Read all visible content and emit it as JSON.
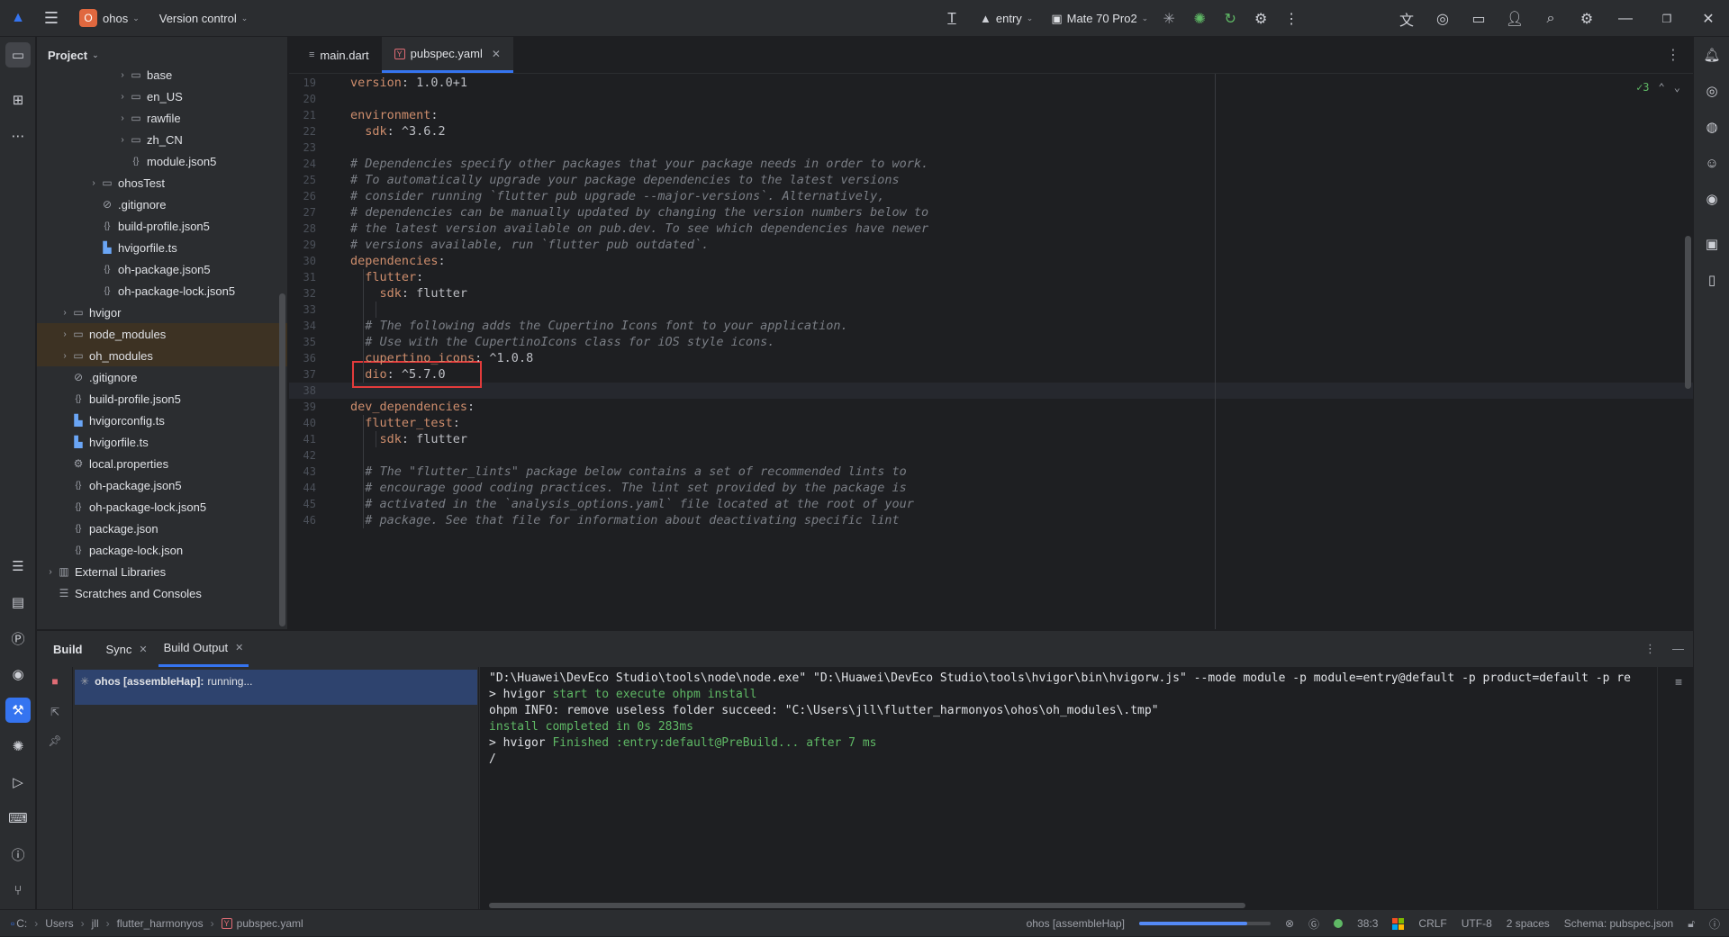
{
  "titlebar": {
    "project_badge": "O",
    "project_name": "ohos",
    "vcs": "Version control",
    "run_config": "entry",
    "device": "Mate 70 Pro2"
  },
  "project_panel": {
    "title": "Project",
    "items": [
      {
        "label": "base",
        "type": "folder",
        "indent": 6,
        "arrow": "›"
      },
      {
        "label": "en_US",
        "type": "folder",
        "indent": 6,
        "arrow": "›"
      },
      {
        "label": "rawfile",
        "type": "folder",
        "indent": 6,
        "arrow": "›"
      },
      {
        "label": "zh_CN",
        "type": "folder",
        "indent": 6,
        "arrow": "›"
      },
      {
        "label": "module.json5",
        "type": "json",
        "indent": 6,
        "arrow": ""
      },
      {
        "label": "ohosTest",
        "type": "folder",
        "indent": 4,
        "arrow": "›"
      },
      {
        "label": ".gitignore",
        "type": "ignore",
        "indent": 4,
        "arrow": ""
      },
      {
        "label": "build-profile.json5",
        "type": "json",
        "indent": 4,
        "arrow": ""
      },
      {
        "label": "hvigorfile.ts",
        "type": "ts",
        "indent": 4,
        "arrow": ""
      },
      {
        "label": "oh-package.json5",
        "type": "json",
        "indent": 4,
        "arrow": ""
      },
      {
        "label": "oh-package-lock.json5",
        "type": "json",
        "indent": 4,
        "arrow": ""
      },
      {
        "label": "hvigor",
        "type": "folder",
        "indent": 2,
        "arrow": "›"
      },
      {
        "label": "node_modules",
        "type": "folder",
        "indent": 2,
        "arrow": "›",
        "excluded": true
      },
      {
        "label": "oh_modules",
        "type": "folder",
        "indent": 2,
        "arrow": "›",
        "excluded": true
      },
      {
        "label": ".gitignore",
        "type": "ignore",
        "indent": 2,
        "arrow": ""
      },
      {
        "label": "build-profile.json5",
        "type": "json",
        "indent": 2,
        "arrow": ""
      },
      {
        "label": "hvigorconfig.ts",
        "type": "ts",
        "indent": 2,
        "arrow": ""
      },
      {
        "label": "hvigorfile.ts",
        "type": "ts",
        "indent": 2,
        "arrow": ""
      },
      {
        "label": "local.properties",
        "type": "props",
        "indent": 2,
        "arrow": ""
      },
      {
        "label": "oh-package.json5",
        "type": "json",
        "indent": 2,
        "arrow": ""
      },
      {
        "label": "oh-package-lock.json5",
        "type": "json",
        "indent": 2,
        "arrow": ""
      },
      {
        "label": "package.json",
        "type": "json",
        "indent": 2,
        "arrow": ""
      },
      {
        "label": "package-lock.json",
        "type": "json",
        "indent": 2,
        "arrow": ""
      },
      {
        "label": "External Libraries",
        "type": "lib",
        "indent": 1,
        "arrow": "›"
      },
      {
        "label": "Scratches and Consoles",
        "type": "scratch",
        "indent": 1,
        "arrow": ""
      }
    ]
  },
  "editor": {
    "tabs": [
      {
        "label": "main.dart",
        "active": false
      },
      {
        "label": "pubspec.yaml",
        "active": true
      }
    ],
    "inspection_count": "3",
    "lines": [
      {
        "n": "19",
        "text": "version: 1.0.0+1"
      },
      {
        "n": "20",
        "text": ""
      },
      {
        "n": "21",
        "text": "environment:"
      },
      {
        "n": "22",
        "text": "  sdk: ^3.6.2"
      },
      {
        "n": "23",
        "text": ""
      },
      {
        "n": "24",
        "text": "# Dependencies specify other packages that your package needs in order to work."
      },
      {
        "n": "25",
        "text": "# To automatically upgrade your package dependencies to the latest versions"
      },
      {
        "n": "26",
        "text": "# consider running `flutter pub upgrade --major-versions`. Alternatively,"
      },
      {
        "n": "27",
        "text": "# dependencies can be manually updated by changing the version numbers below to"
      },
      {
        "n": "28",
        "text": "# the latest version available on pub.dev. To see which dependencies have newer"
      },
      {
        "n": "29",
        "text": "# versions available, run `flutter pub outdated`."
      },
      {
        "n": "30",
        "text": "dependencies:"
      },
      {
        "n": "31",
        "text": "  flutter:"
      },
      {
        "n": "32",
        "text": "    sdk: flutter"
      },
      {
        "n": "33",
        "text": ""
      },
      {
        "n": "34",
        "text": "  # The following adds the Cupertino Icons font to your application."
      },
      {
        "n": "35",
        "text": "  # Use with the CupertinoIcons class for iOS style icons."
      },
      {
        "n": "36",
        "text": "  cupertino_icons: ^1.0.8"
      },
      {
        "n": "37",
        "text": "  dio: ^5.7.0"
      },
      {
        "n": "38",
        "text": ""
      },
      {
        "n": "39",
        "text": "dev_dependencies:"
      },
      {
        "n": "40",
        "text": "  flutter_test:"
      },
      {
        "n": "41",
        "text": "    sdk: flutter"
      },
      {
        "n": "42",
        "text": ""
      },
      {
        "n": "43",
        "text": "  # The \"flutter_lints\" package below contains a set of recommended lints to"
      },
      {
        "n": "44",
        "text": "  # encourage good coding practices. The lint set provided by the package is"
      },
      {
        "n": "45",
        "text": "  # activated in the `analysis_options.yaml` file located at the root of your"
      },
      {
        "n": "46",
        "text": "  # package. See that file for information about deactivating specific lint"
      }
    ]
  },
  "build": {
    "title": "Build",
    "tabs": [
      {
        "label": "Sync",
        "active": false
      },
      {
        "label": "Build Output",
        "active": true
      }
    ],
    "task_name": "ohos [assembleHap]:",
    "task_status": "running...",
    "console": [
      {
        "text": "\"D:\\Huawei\\DevEco Studio\\tools\\node\\node.exe\" \"D:\\Huawei\\DevEco Studio\\tools\\hvigor\\bin\\hvigorw.js\" --mode module -p module=entry@default -p product=default -p re",
        "style": "plain"
      },
      {
        "prefix": "> hvigor ",
        "text": "start to execute ohpm install",
        "style": "green"
      },
      {
        "text": "ohpm INFO: remove useless folder succeed: \"C:\\Users\\jll\\flutter_harmonyos\\ohos\\oh_modules\\.tmp\"",
        "style": "plain"
      },
      {
        "text": "install completed in 0s 283ms",
        "style": "green-all"
      },
      {
        "prefix": "> hvigor ",
        "text": "Finished :entry:default@PreBuild... after 7 ms",
        "style": "green"
      },
      {
        "text": "/",
        "style": "plain"
      }
    ]
  },
  "status": {
    "breadcrumbs": [
      "C:",
      "Users",
      "jll",
      "flutter_harmonyos",
      "pubspec.yaml"
    ],
    "task": "ohos [assembleHap]",
    "progress_fraction": 0.82,
    "position": "38:3",
    "line_ending": "CRLF",
    "encoding": "UTF-8",
    "indent": "2 spaces",
    "schema": "Schema: pubspec.json"
  }
}
